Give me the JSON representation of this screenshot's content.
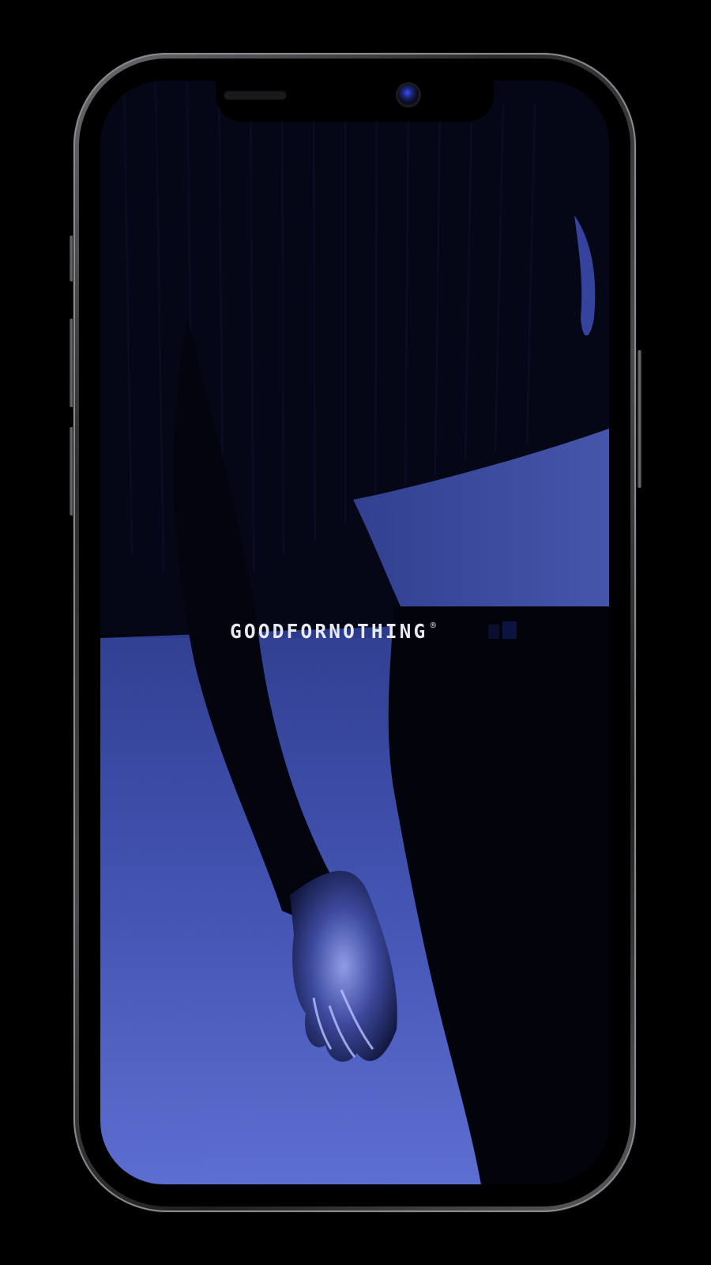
{
  "brand": {
    "wordmark": "GOODFORNOTHING",
    "registered_mark": "®"
  },
  "colors": {
    "background": "#000000",
    "screen_shadow": "#02030a",
    "blue_tint": "#4a5ab8",
    "logo_text": "#e6e8f2"
  },
  "device": {
    "type": "smartphone mockup"
  }
}
